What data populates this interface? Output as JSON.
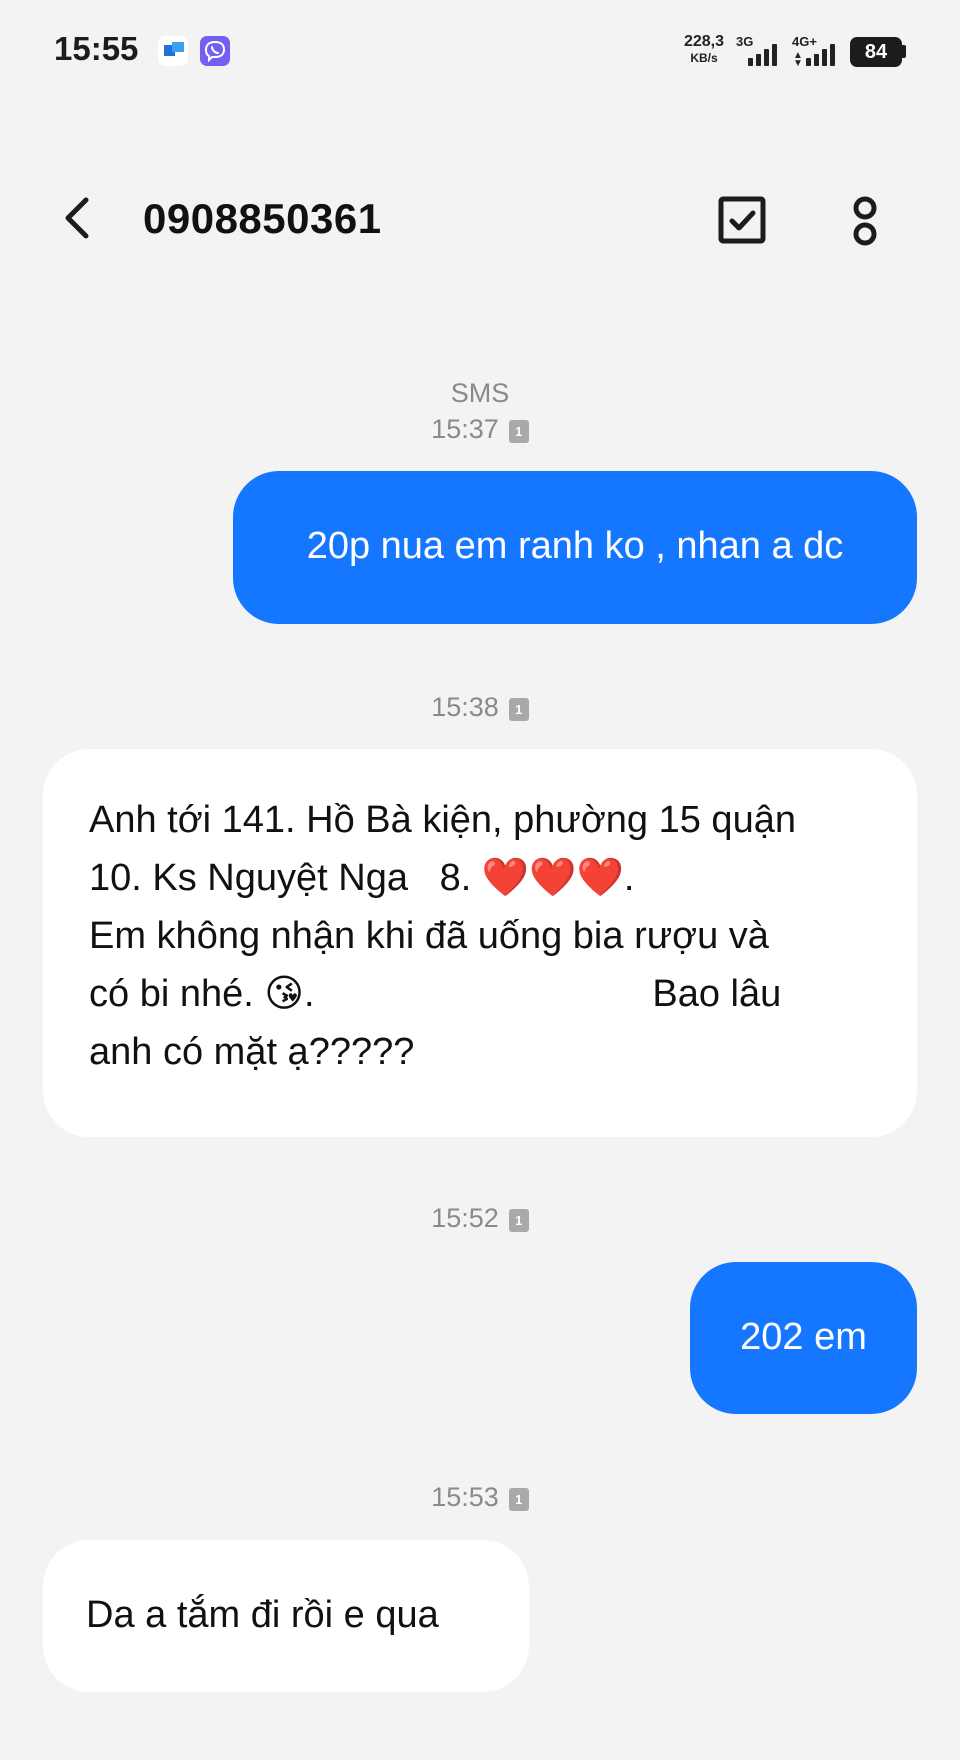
{
  "status_bar": {
    "time": "15:55",
    "net_speed_value": "228,3",
    "net_speed_unit": "KB/s",
    "signal_1_label": "3G",
    "signal_2_label": "4G+",
    "battery": "84",
    "notification_icons": [
      "outlook-icon",
      "viber-icon"
    ]
  },
  "header": {
    "title": "0908850361",
    "back_icon": "chevron-left-icon",
    "select_icon": "checkbox-icon",
    "more_icon": "more-vertical-icon"
  },
  "conversation": {
    "channel_label": "SMS",
    "messages": [
      {
        "direction": "outgoing",
        "time": "15:37",
        "sim": "1",
        "lines": [
          "20p nua em ranh ko , nhan a dc"
        ]
      },
      {
        "direction": "incoming",
        "time": "15:38",
        "sim": "1",
        "lines": [
          "Anh tới 141. Hồ Bà kiện, phường 15 quận",
          "10. Ks Nguyệt Nga   8. ❤️❤️❤️.",
          "Em không nhận khi đã uống bia rượu và",
          "có bi nhé. 😘.                                Bao lâu",
          "anh có mặt ạ?????"
        ]
      },
      {
        "direction": "outgoing",
        "time": "15:52",
        "sim": "1",
        "lines": [
          "202 em"
        ]
      },
      {
        "direction": "incoming",
        "time": "15:53",
        "sim": "1",
        "lines": [
          "Da a tắm đi rồi e qua"
        ]
      }
    ]
  },
  "colors": {
    "background": "#f3f3f3",
    "outgoing_bubble": "#1577ff",
    "incoming_bubble": "#ffffff",
    "meta_text": "#8a8a8a"
  }
}
